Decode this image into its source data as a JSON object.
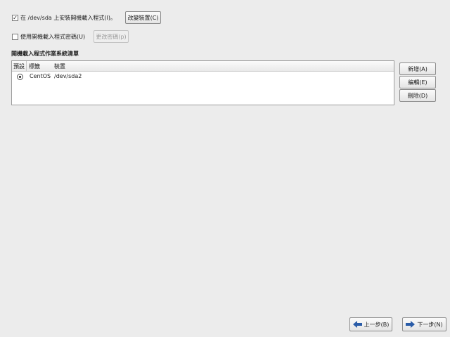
{
  "install_bootloader": {
    "checked": true,
    "label": "在 /dev/sda 上安裝開機載入程式(I)。",
    "change_device_button": "改變裝置(C)"
  },
  "bootloader_password": {
    "checked": false,
    "label": "使用開機載入程式密碼(U)",
    "change_password_button": "更改密碼(p)"
  },
  "os_list": {
    "title": "開機載入程式作業系統清單",
    "columns": [
      "預設",
      "標籤",
      "裝置"
    ],
    "rows": [
      {
        "default": true,
        "label": "CentOS",
        "device": "/dev/sda2"
      }
    ]
  },
  "list_actions": {
    "add": "新增(A)",
    "edit": "編輯(E)",
    "delete": "刪除(D)"
  },
  "nav": {
    "back": "上一步(B)",
    "next": "下一步(N)"
  },
  "colors": {
    "background": "#ececec",
    "arrow": "#2a5ca8"
  }
}
